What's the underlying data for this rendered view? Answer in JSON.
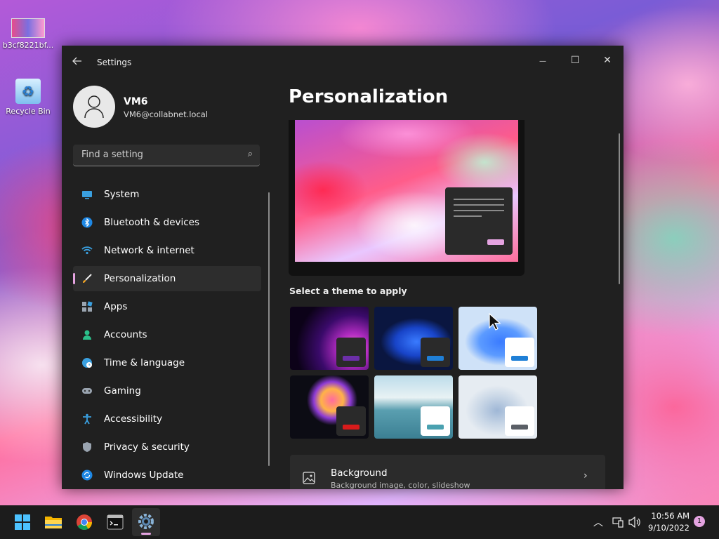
{
  "desktop": {
    "icons": [
      {
        "label": "b3cf8221bf..."
      },
      {
        "label": "Recycle Bin"
      }
    ]
  },
  "window": {
    "title": "Settings",
    "controls": {
      "minimize": "—",
      "maximize": "☐",
      "close": "✕"
    }
  },
  "user": {
    "name": "VM6",
    "email": "VM6@collabnet.local"
  },
  "search": {
    "placeholder": "Find a setting"
  },
  "sidebar": {
    "items": [
      {
        "label": "System",
        "icon": "monitor-icon"
      },
      {
        "label": "Bluetooth & devices",
        "icon": "bluetooth-icon"
      },
      {
        "label": "Network & internet",
        "icon": "wifi-icon"
      },
      {
        "label": "Personalization",
        "icon": "brush-icon",
        "active": true
      },
      {
        "label": "Apps",
        "icon": "apps-icon"
      },
      {
        "label": "Accounts",
        "icon": "person-icon"
      },
      {
        "label": "Time & language",
        "icon": "clock-globe-icon"
      },
      {
        "label": "Gaming",
        "icon": "gamepad-icon"
      },
      {
        "label": "Accessibility",
        "icon": "accessibility-icon"
      },
      {
        "label": "Privacy & security",
        "icon": "shield-icon"
      },
      {
        "label": "Windows Update",
        "icon": "update-icon"
      }
    ]
  },
  "main": {
    "title": "Personalization",
    "themes_label": "Select a theme to apply",
    "themes": [
      {
        "name": "glow-dark",
        "accent": "#6b2fa8"
      },
      {
        "name": "bloom-dark",
        "accent": "#1f7fd6"
      },
      {
        "name": "bloom-light",
        "accent": "#1f7fd6"
      },
      {
        "name": "captured-motion",
        "accent": "#d81b1b"
      },
      {
        "name": "sunrise",
        "accent": "#4aa1b0"
      },
      {
        "name": "flow",
        "accent": "#5a5f66"
      }
    ],
    "background_card": {
      "title": "Background",
      "subtitle": "Background image, color, slideshow"
    }
  },
  "taskbar": {
    "apps": [
      "start-icon",
      "file-explorer-icon",
      "chrome-icon",
      "terminal-icon",
      "settings-icon"
    ],
    "clock": {
      "time": "10:56 AM",
      "date": "9/10/2022"
    },
    "notifications": "1"
  },
  "colors": {
    "accent": "#e4a3e0",
    "window_bg": "#202020",
    "taskbar_bg": "#1c1c1c"
  }
}
